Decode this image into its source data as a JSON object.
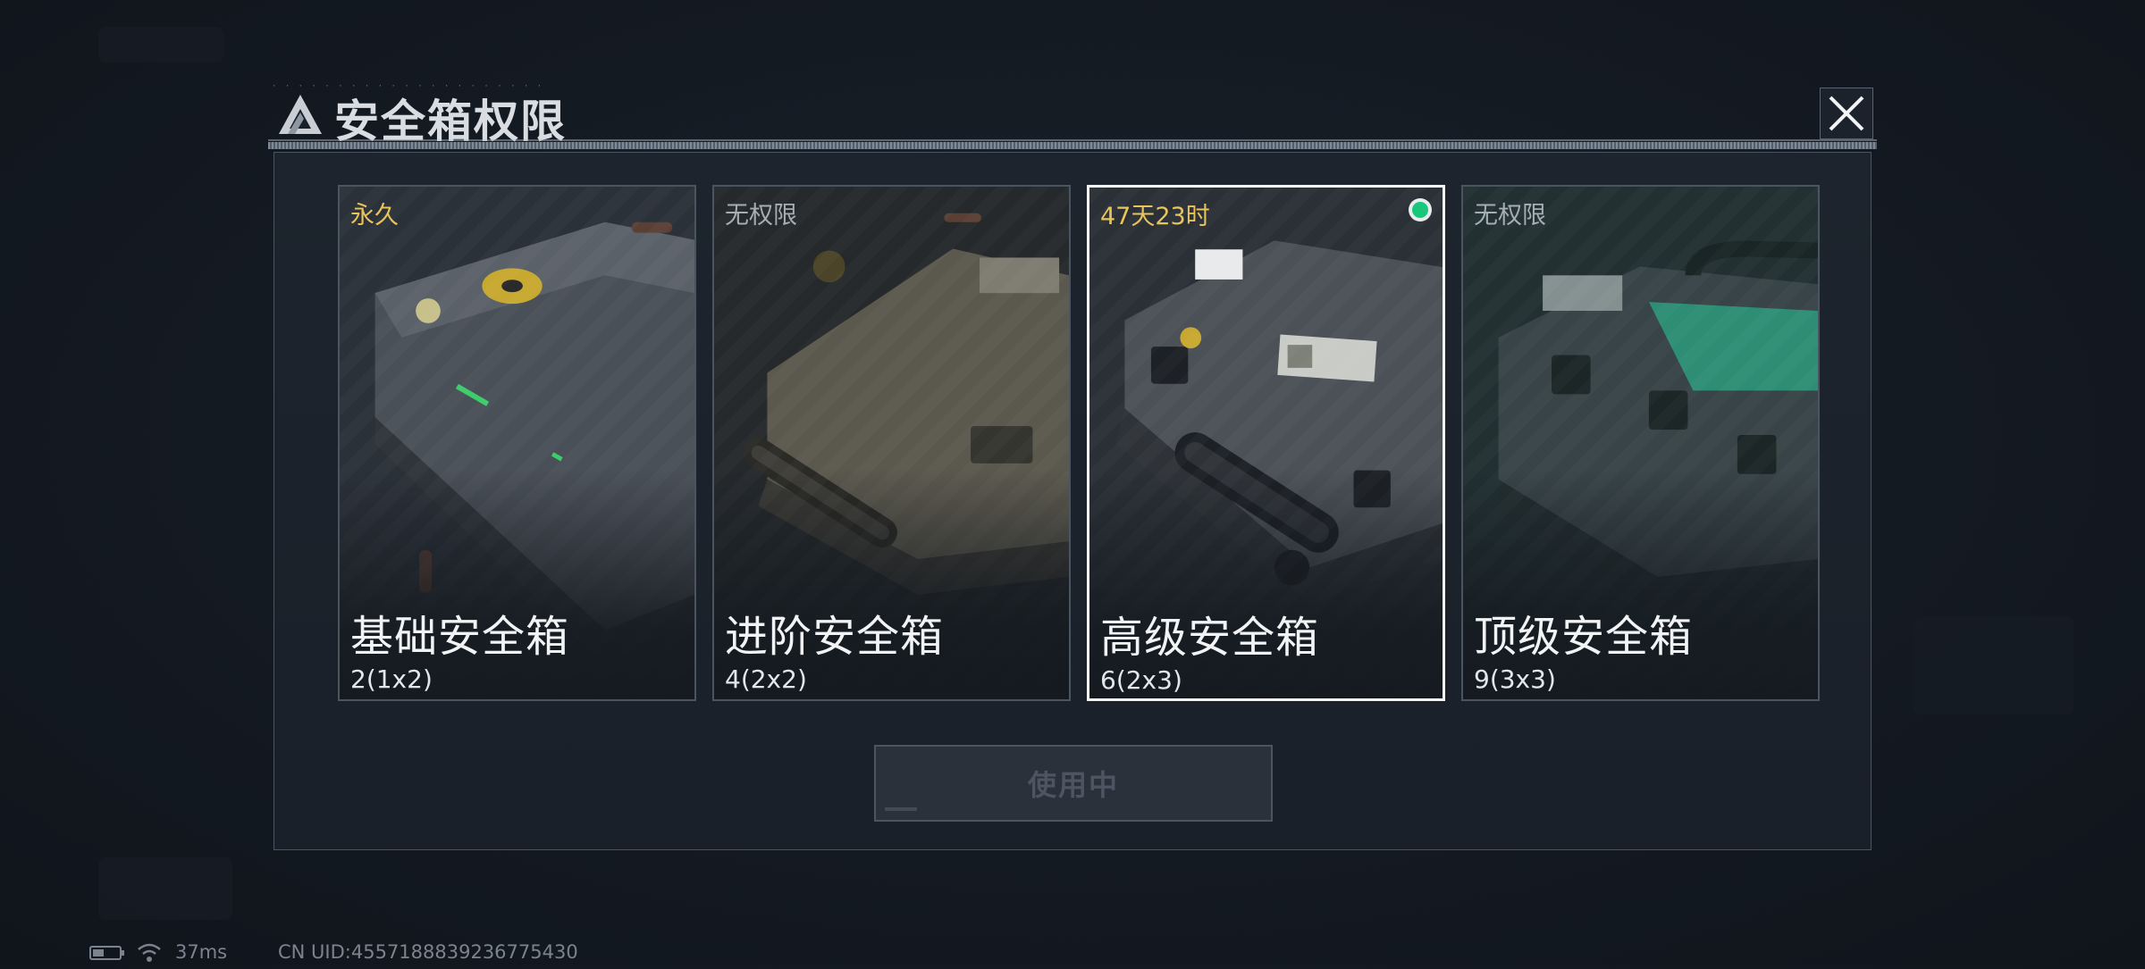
{
  "dialog": {
    "title": "安全箱权限",
    "action_button": "使用中"
  },
  "cards": [
    {
      "status": "永久",
      "name": "基础安全箱",
      "size": "2(1x2)"
    },
    {
      "status": "无权限",
      "name": "进阶安全箱",
      "size": "4(2x2)"
    },
    {
      "status": "47天23时",
      "name": "高级安全箱",
      "size": "6(2x3)",
      "selected": true
    },
    {
      "status": "无权限",
      "name": "顶级安全箱",
      "size": "9(3x3)"
    }
  ],
  "footer": {
    "ping": "37ms",
    "uid": "CN UID:4557188839236775430"
  },
  "colors": {
    "accent_gold": "#e8c45a",
    "active_green": "#19c77a"
  }
}
